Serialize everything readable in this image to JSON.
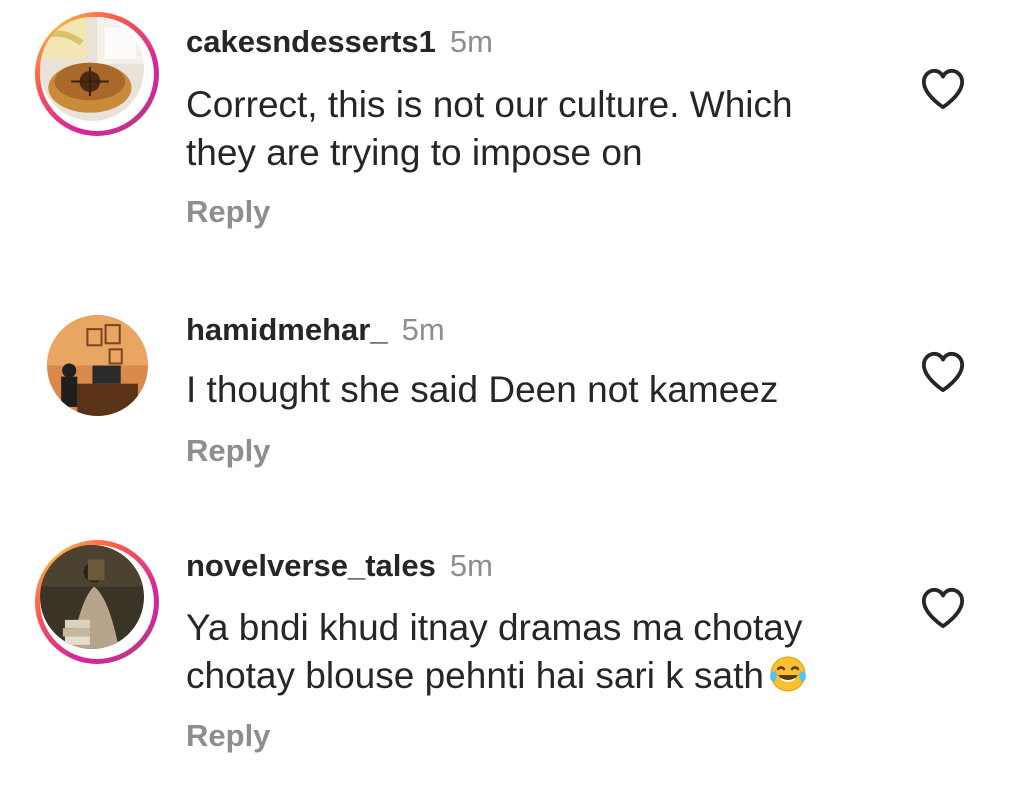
{
  "comments": [
    {
      "username": "cakesndesserts1",
      "time": "5m",
      "text_line1": "Correct, this is not our culture. Which",
      "text_line2": "they are  trying to  impose on",
      "reply_label": "Reply",
      "like_icon": "heart-outline-icon"
    },
    {
      "username": "hamidmehar_",
      "time": "5m",
      "text_line1": "I thought she said Deen not kameez",
      "reply_label": "Reply",
      "like_icon": "heart-outline-icon"
    },
    {
      "username": "novelverse_tales",
      "time": "5m",
      "text_line1": "Ya bndi khud itnay dramas ma chotay",
      "text_line2": "chotay blouse pehnti hai sari k sath",
      "emoji": "face-with-tears-of-joy-emoji",
      "reply_label": "Reply",
      "like_icon": "heart-outline-icon"
    }
  ],
  "colors": {
    "text": "#262626",
    "secondary": "#8e8e8e",
    "story_ring_start": "#d6249f",
    "story_ring_end": "#fdb045"
  }
}
